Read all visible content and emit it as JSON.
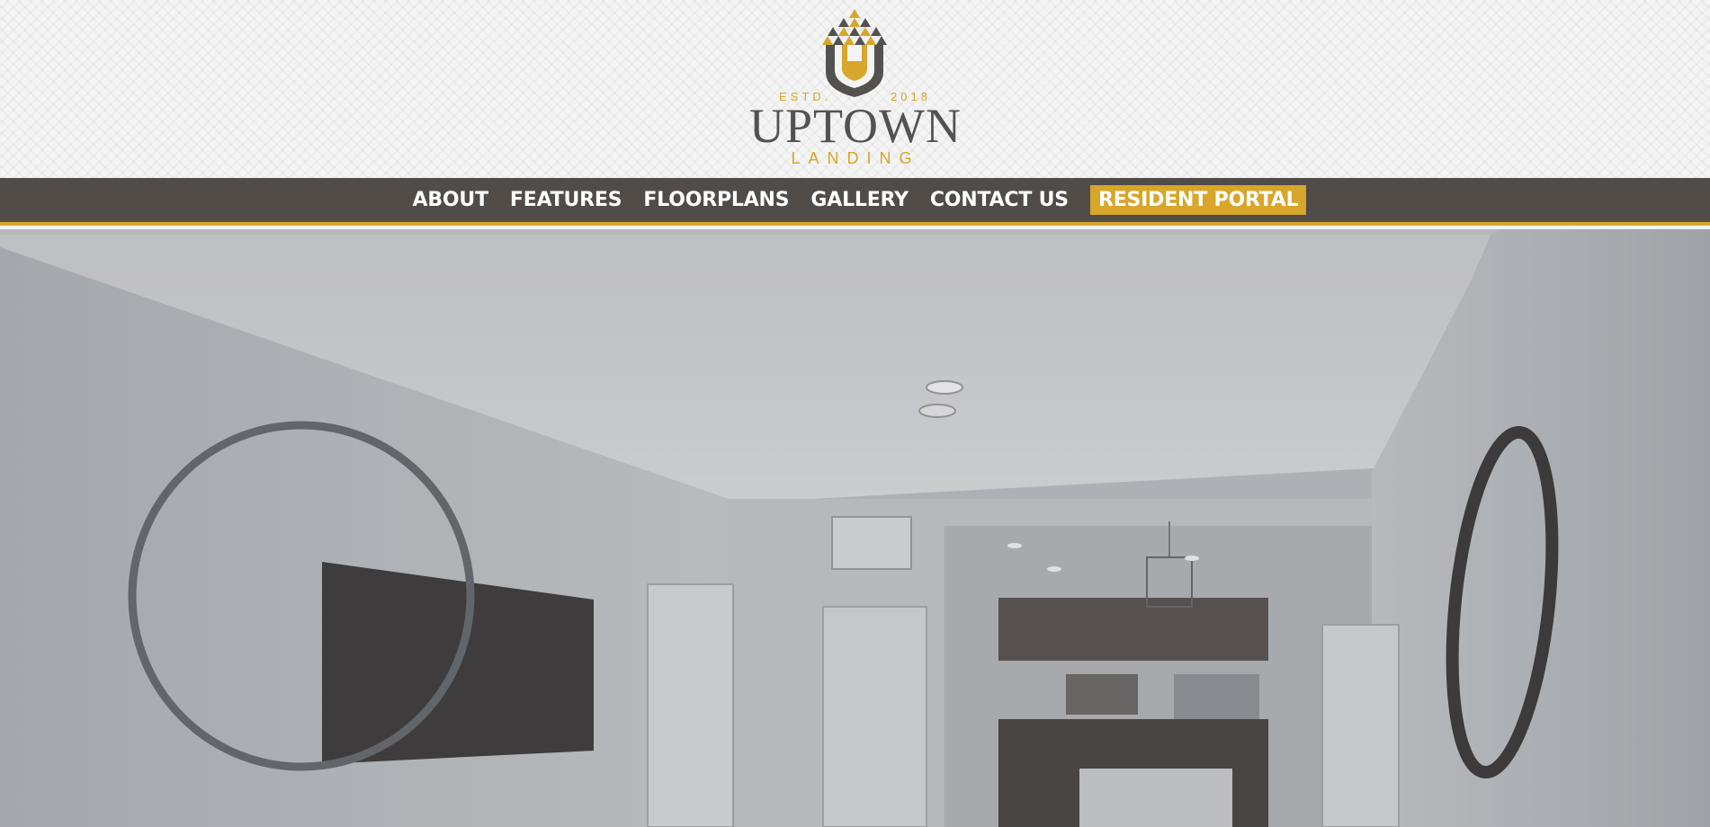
{
  "brand": {
    "estd_label": "ESTD.",
    "estd_year": "2018",
    "name": "UPTOWN",
    "subtitle": "LANDING",
    "icon": "acorn-shield-logo",
    "colors": {
      "gold": "#d7a62a",
      "charcoal": "#524c48"
    }
  },
  "nav": {
    "items": [
      {
        "label": "ABOUT"
      },
      {
        "label": "FEATURES"
      },
      {
        "label": "FLOORPLANS"
      },
      {
        "label": "GALLERY"
      },
      {
        "label": "CONTACT US"
      }
    ],
    "portal_label": "RESIDENT PORTAL"
  },
  "hero": {
    "image": "apartment-living-room-photo"
  }
}
